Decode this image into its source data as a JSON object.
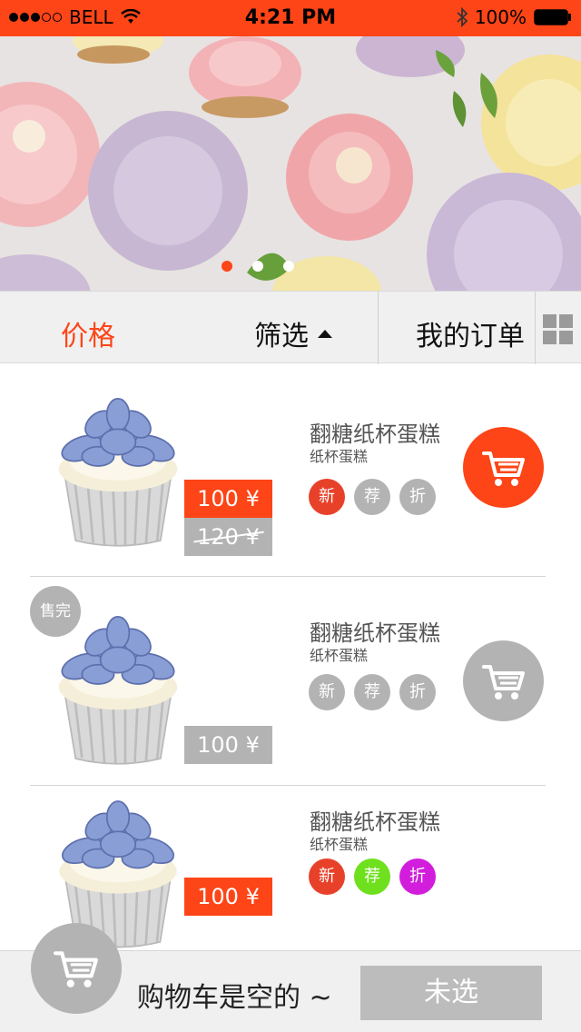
{
  "status_bar": {
    "carrier": "BELL",
    "time": "4:21 PM",
    "battery": "100%"
  },
  "banner": {
    "image": "cupcakes-banner",
    "dots": 3,
    "active_dot": 0
  },
  "filter_bar": {
    "price_label": "价格",
    "filter_label": "筛选",
    "orders_label": "我的订单",
    "active_tab": "price",
    "grid_icon": "grid-view-icon"
  },
  "colors": {
    "accent": "#fd4517",
    "gray": "#b3b3b3",
    "tag_new": "#e8412a",
    "tag_recommend_green": "#6fe01d",
    "tag_discount_magenta": "#d21ddc"
  },
  "products": [
    {
      "title": "翻糖纸杯蛋糕",
      "subtitle": "纸杯蛋糕",
      "price": "100 ¥",
      "old_price": "120 ¥",
      "sold_out": false,
      "tags": [
        "新",
        "荐",
        "折"
      ],
      "cart_icon": "shopping-cart-icon"
    },
    {
      "title": "翻糖纸杯蛋糕",
      "subtitle": "纸杯蛋糕",
      "price": "100 ¥",
      "sold_out_label": "售完",
      "sold_out": true,
      "tags": [
        "新",
        "荐",
        "折"
      ],
      "cart_icon": "shopping-cart-icon"
    },
    {
      "title": "翻糖纸杯蛋糕",
      "subtitle": "纸杯蛋糕",
      "price": "100 ¥",
      "sold_out": false,
      "tags": [
        "新",
        "荐",
        "折"
      ]
    }
  ],
  "cart_bar": {
    "empty_text": "购物车是空的 ~",
    "checkout_label": "未选",
    "cart_icon": "shopping-cart-icon"
  }
}
